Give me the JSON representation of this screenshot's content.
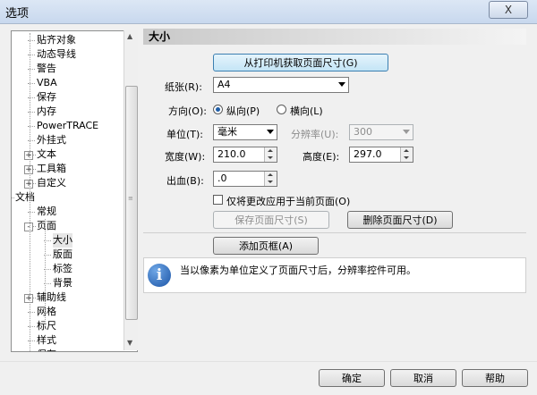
{
  "window": {
    "title": "选项",
    "close_label": "X"
  },
  "tree": {
    "items": [
      {
        "label": "贴齐对象",
        "level": 2
      },
      {
        "label": "动态导线",
        "level": 2
      },
      {
        "label": "警告",
        "level": 2
      },
      {
        "label": "VBA",
        "level": 2
      },
      {
        "label": "保存",
        "level": 2
      },
      {
        "label": "内存",
        "level": 2
      },
      {
        "label": "PowerTRACE",
        "level": 2
      },
      {
        "label": "外挂式",
        "level": 2
      },
      {
        "label": "文本",
        "level": 2,
        "expander": "+"
      },
      {
        "label": "工具箱",
        "level": 2,
        "expander": "+"
      },
      {
        "label": "自定义",
        "level": 2,
        "expander": "+"
      },
      {
        "label": "文档",
        "level": 1,
        "expander": "-"
      },
      {
        "label": "常规",
        "level": 2
      },
      {
        "label": "页面",
        "level": 2,
        "expander": "-"
      },
      {
        "label": "大小",
        "level": 3,
        "selected": true
      },
      {
        "label": "版面",
        "level": 3
      },
      {
        "label": "标签",
        "level": 3
      },
      {
        "label": "背景",
        "level": 3
      },
      {
        "label": "辅助线",
        "level": 2,
        "expander": "+"
      },
      {
        "label": "网格",
        "level": 2
      },
      {
        "label": "标尺",
        "level": 2
      },
      {
        "label": "样式",
        "level": 2
      },
      {
        "label": "保存",
        "level": 2
      }
    ]
  },
  "panel": {
    "header": "大小",
    "get_from_printer_button": "从打印机获取页面尺寸(G)",
    "paper_label": "纸张(R):",
    "paper_value": "A4",
    "orientation_label": "方向(O):",
    "portrait_label": "纵向(P)",
    "landscape_label": "横向(L)",
    "unit_label": "单位(T):",
    "unit_value": "毫米",
    "resolution_label": "分辨率(U):",
    "resolution_value": "300",
    "width_label": "宽度(W):",
    "width_value": "210.0",
    "height_label": "高度(E):",
    "height_value": "297.0",
    "bleed_label": "出血(B):",
    "bleed_value": ".0",
    "apply_current_only_label": "仅将更改应用于当前页面(O)",
    "save_page_size_button": "保存页面尺寸(S)",
    "delete_page_size_button": "删除页面尺寸(D)",
    "add_page_frame_button": "添加页框(A)",
    "info_icon_glyph": "i",
    "info_text": "当以像素为单位定义了页面尺寸后，分辨率控件可用。"
  },
  "footer": {
    "ok": "确定",
    "cancel": "取消",
    "help": "帮助"
  }
}
